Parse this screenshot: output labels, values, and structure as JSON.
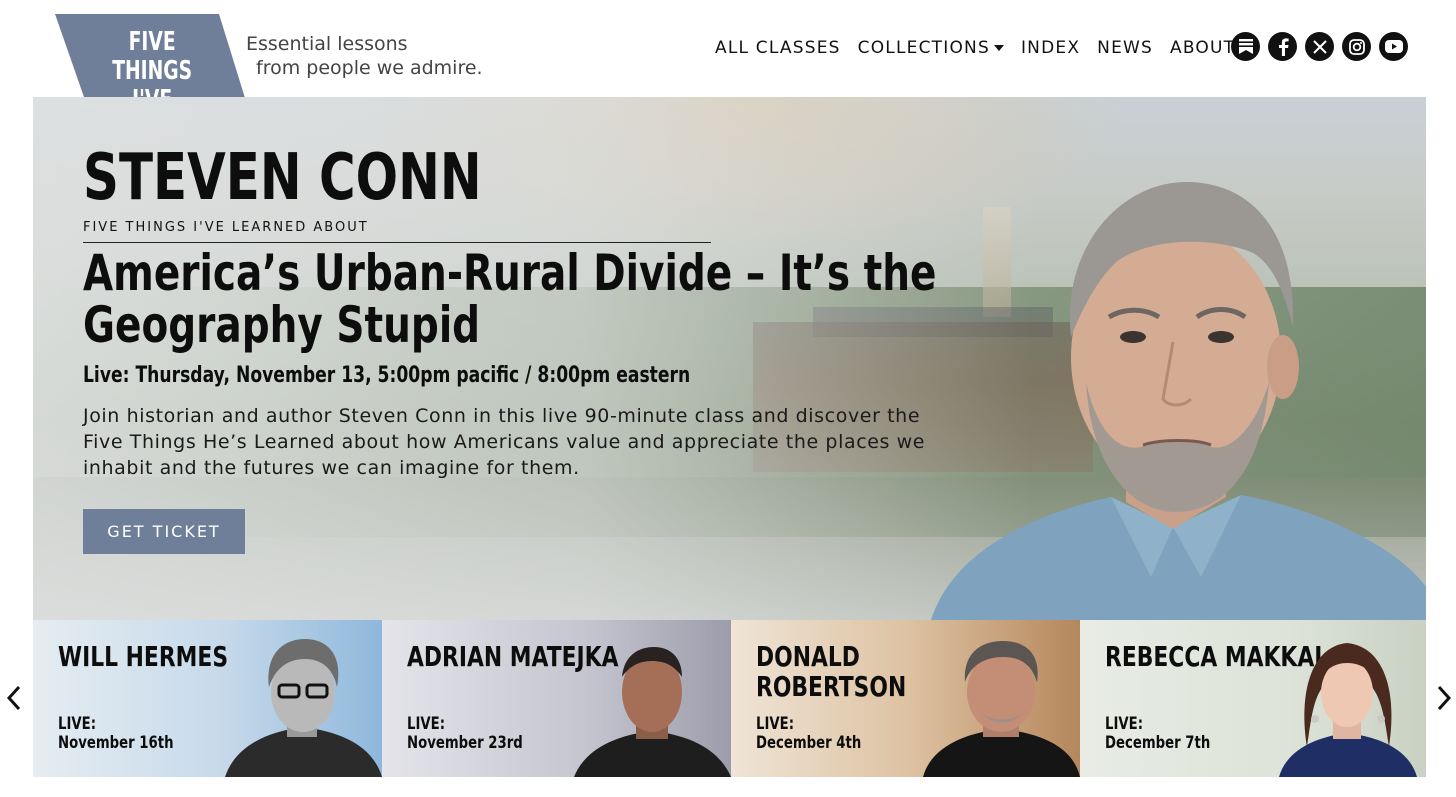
{
  "logo": {
    "line1": "FIVE THINGS",
    "line2": "I'VE LEARNED",
    "color": "#6f7f99"
  },
  "tagline": {
    "line1": "Essential lessons",
    "line2": "from people we admire."
  },
  "nav": {
    "all_classes": "ALL CLASSES",
    "collections": "COLLECTIONS",
    "index": "INDEX",
    "news": "NEWS",
    "about": "ABOUT"
  },
  "social": [
    "substack-icon",
    "facebook-icon",
    "x-icon",
    "instagram-icon",
    "youtube-icon"
  ],
  "hero": {
    "host_name": "STEVEN CONN",
    "kicker": "FIVE THINGS I'VE LEARNED ABOUT",
    "class_title": "America’s Urban-Rural Divide – It’s the Geography Stupid",
    "live_line": "Live: Thursday, November 13, 5:00pm pacific / 8:00pm eastern",
    "description": "Join historian and author Steven Conn in this live 90-minute class and discover the Five Things He’s Learned about how Americans value and appreciate the places we inhabit and the futures we can imagine for them.",
    "cta_label": "GET TICKET",
    "cta_color": "#6f7f99"
  },
  "carousel": {
    "cards": [
      {
        "name": "WILL HERMES",
        "live_label": "LIVE:",
        "date": "November 16th"
      },
      {
        "name": "ADRIAN MATEJKA",
        "live_label": "LIVE:",
        "date": "November 23rd"
      },
      {
        "name": "DONALD\nROBERTSON",
        "live_label": "LIVE:",
        "date": "December 4th"
      },
      {
        "name": "REBECCA MAKKAI",
        "live_label": "LIVE:",
        "date": "December 7th"
      }
    ]
  }
}
